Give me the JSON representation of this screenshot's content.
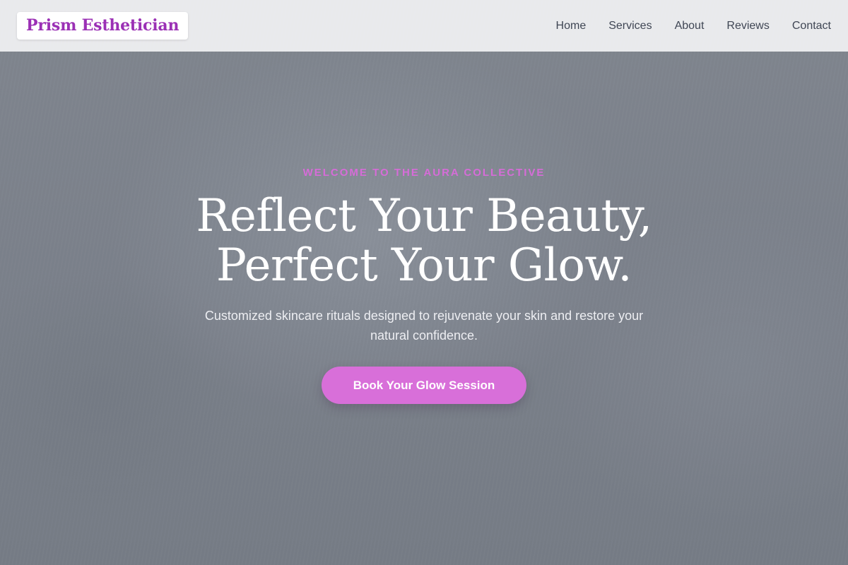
{
  "brand": {
    "name": "Prism Esthetician",
    "color": "#9b30b5"
  },
  "nav": {
    "items": [
      {
        "label": "Home"
      },
      {
        "label": "Services"
      },
      {
        "label": "About"
      },
      {
        "label": "Reviews"
      },
      {
        "label": "Contact"
      }
    ]
  },
  "hero": {
    "eyebrow": "WELCOME TO THE AURA COLLECTIVE",
    "headline_line1": "Reflect Your Beauty,",
    "headline_line2": "Perfect Your Glow.",
    "subtitle": "Customized skincare rituals designed to rejuvenate your skin and restore your natural confidence.",
    "cta_label": "Book Your Glow Session",
    "accent_color": "#d86fd9"
  }
}
